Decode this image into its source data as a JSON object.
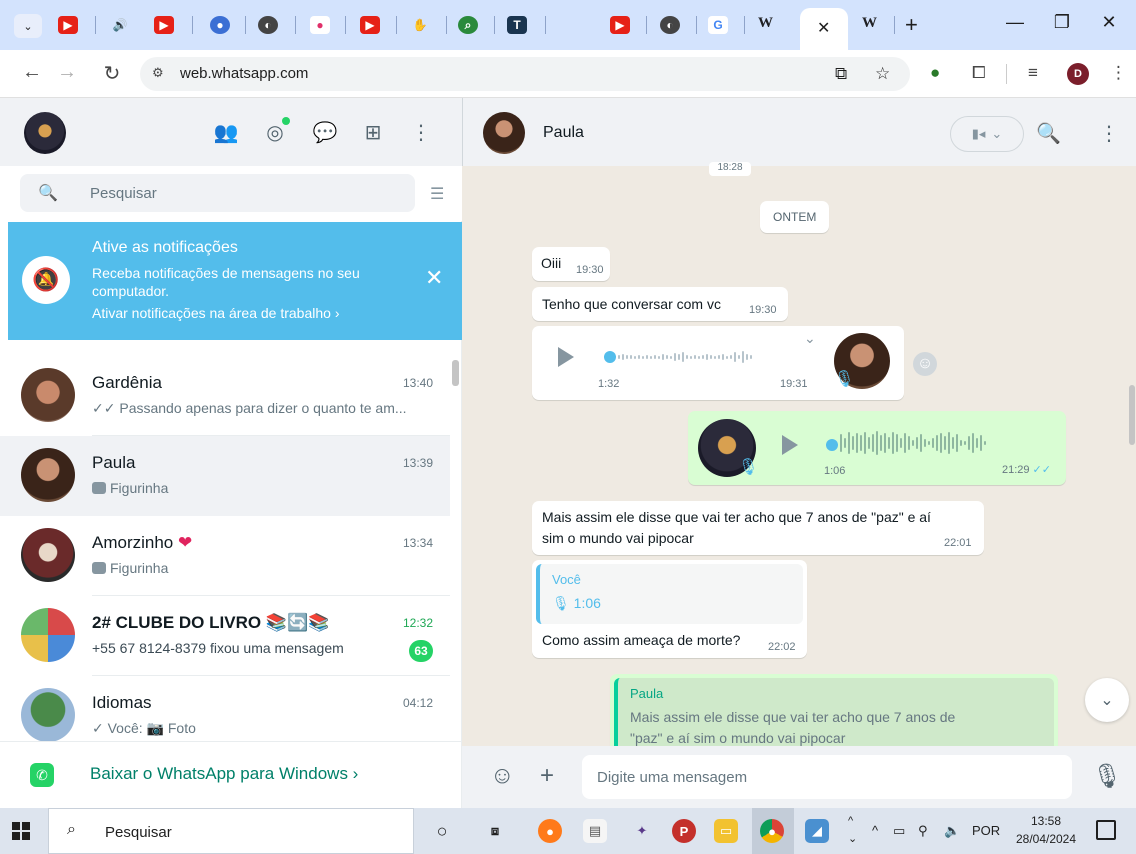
{
  "browser": {
    "url": "web.whatsapp.com",
    "tab_letters": {
      "t_tab": "T",
      "g_tab": "G",
      "w_tab": "W"
    }
  },
  "whatsapp": {
    "search_placeholder": "Pesquisar",
    "notification": {
      "title": "Ative as notificações",
      "body": "Receba notificações de mensagens no seu computador.",
      "link": "Ativar notificações na área de trabalho ›"
    },
    "chats": [
      {
        "name": "Gardênia",
        "time": "13:40",
        "preview": "✓✓ Passando apenas para dizer o quanto te am..."
      },
      {
        "name": "Paula",
        "time": "13:39",
        "preview": "Figurinha"
      },
      {
        "name": "Amorzinho",
        "name_suffix": "❤",
        "time": "13:34",
        "preview": "Figurinha"
      },
      {
        "name": "2# CLUBE DO LIVRO",
        "name_suffix": "📚🔄📚",
        "time": "12:32",
        "preview": "+55 67 8124-8379 fixou uma mensagem",
        "unread": "63"
      },
      {
        "name": "Idiomas",
        "time": "04:12",
        "preview": "✓ Você: 📷 Foto"
      }
    ],
    "download_banner": "Baixar o WhatsApp para Windows ›",
    "conversation": {
      "contact_name": "Paula",
      "date_top": "18:28",
      "date_chip": "ONTEM",
      "messages": {
        "m1": {
          "text": "Oiii",
          "time": "19:30"
        },
        "m2": {
          "text": "Tenho que conversar com vc",
          "time": "19:30"
        },
        "audio_in": {
          "duration": "1:32",
          "time": "19:31"
        },
        "audio_out": {
          "duration": "1:06",
          "time": "21:29"
        },
        "m3": {
          "line1": "Mais assim ele disse que vai ter acho que 7 anos de \"paz\" e aí",
          "line2": "sim o mundo vai pipocar",
          "time": "22:01"
        },
        "m4": {
          "quote_name": "Você",
          "quote_body": "🎙 1:06",
          "text": "Como assim ameaça de morte?",
          "time": "22:02"
        },
        "m5": {
          "quote_name": "Paula",
          "quote_line1": "Mais assim ele disse que vai ter acho que 7 anos de",
          "quote_line2": "\"paz\" e aí sim o mundo vai pipocar"
        }
      },
      "composer_placeholder": "Digite uma mensagem"
    }
  },
  "taskbar": {
    "search_label": "Pesquisar",
    "language": "POR",
    "time": "13:58",
    "date": "28/04/2024"
  },
  "colors": {
    "whatsapp_green": "#25d366",
    "notification_blue": "#53bdeb",
    "outgoing_bubble": "#d9fdd3",
    "chat_background": "#efeae2"
  }
}
